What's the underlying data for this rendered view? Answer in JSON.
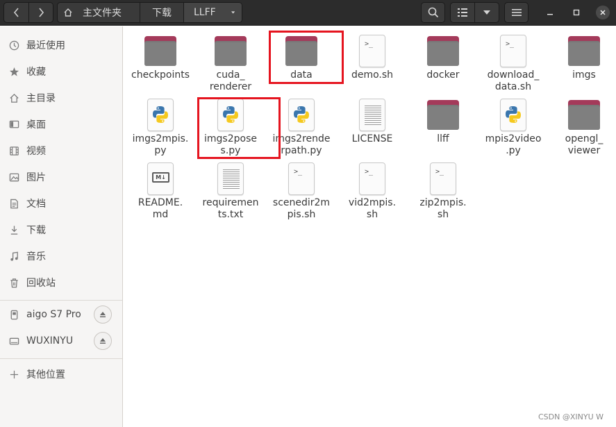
{
  "header": {
    "back_icon": "chevron-left-icon",
    "forward_icon": "chevron-right-icon",
    "breadcrumb": [
      "主文件夹",
      "下载",
      "LLFF"
    ],
    "search_icon": "search-icon",
    "view_list_icon": "list-view-icon",
    "view_dropdown_icon": "chevron-down-icon",
    "menu_icon": "hamburger-menu-icon",
    "minimize_icon": "minimize-icon",
    "maximize_icon": "maximize-icon",
    "close_icon": "close-icon"
  },
  "sidebar": {
    "places": [
      {
        "label": "最近使用",
        "icon": "clock-icon"
      },
      {
        "label": "收藏",
        "icon": "star-icon"
      },
      {
        "label": "主目录",
        "icon": "home-icon"
      },
      {
        "label": "桌面",
        "icon": "desktop-icon"
      },
      {
        "label": "视频",
        "icon": "film-icon"
      },
      {
        "label": "图片",
        "icon": "image-icon"
      },
      {
        "label": "文档",
        "icon": "document-icon"
      },
      {
        "label": "下载",
        "icon": "download-icon"
      },
      {
        "label": "音乐",
        "icon": "music-icon"
      },
      {
        "label": "回收站",
        "icon": "trash-icon"
      }
    ],
    "devices": [
      {
        "label": "aigo S7 Pro",
        "icon": "drive-icon"
      },
      {
        "label": "WUXINYU",
        "icon": "drive-icon"
      }
    ],
    "other_locations": {
      "label": "其他位置",
      "icon": "plus-icon"
    }
  },
  "files": [
    {
      "name": "checkpoints",
      "type": "folder"
    },
    {
      "name": "cuda_\nrenderer",
      "type": "folder"
    },
    {
      "name": "data",
      "type": "folder"
    },
    {
      "name": "demo.sh",
      "type": "script"
    },
    {
      "name": "docker",
      "type": "folder"
    },
    {
      "name": "download_\ndata.sh",
      "type": "script"
    },
    {
      "name": "imgs",
      "type": "folder"
    },
    {
      "name": "imgs2mpis.\npy",
      "type": "python"
    },
    {
      "name": "imgs2pose\ns.py",
      "type": "python"
    },
    {
      "name": "imgs2rende\nrpath.py",
      "type": "python"
    },
    {
      "name": "LICENSE",
      "type": "text"
    },
    {
      "name": "llff",
      "type": "folder"
    },
    {
      "name": "mpis2video\n.py",
      "type": "python"
    },
    {
      "name": "opengl_\nviewer",
      "type": "folder"
    },
    {
      "name": "README.\nmd",
      "type": "markdown"
    },
    {
      "name": "requiremen\nts.txt",
      "type": "text"
    },
    {
      "name": "scenedir2m\npis.sh",
      "type": "script"
    },
    {
      "name": "vid2mpis.\nsh",
      "type": "script"
    },
    {
      "name": "zip2mpis.\nsh",
      "type": "script"
    }
  ],
  "markdown_badge": "M↓",
  "script_prompt": ">_",
  "colors": {
    "folder_tab": "#a43a5a",
    "folder_body": "#787878",
    "highlight": "#e5141f",
    "headerbar": "#2c2c2c"
  },
  "watermark": "CSDN @XINYU W"
}
